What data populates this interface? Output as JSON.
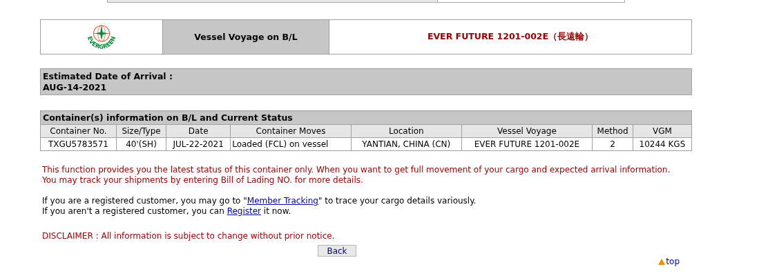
{
  "logo": {
    "text": "EVERGREEN"
  },
  "header": {
    "label": "Vessel Voyage on B/L",
    "value": "EVER FUTURE 1201-002E（長遠輪）"
  },
  "arrival": {
    "label": "Estimated Date of Arrival :",
    "date": "AUG-14-2021"
  },
  "table": {
    "title": "Container(s) information on B/L and Current Status",
    "columns": [
      "Container No.",
      "Size/Type",
      "Date",
      "Container Moves",
      "Location",
      "Vessel Voyage",
      "Method",
      "VGM"
    ],
    "rows": [
      [
        "TXGU5783571",
        "40'(SH)",
        "JUL-22-2021",
        "Loaded (FCL) on vessel",
        "YANTIAN, CHINA (CN)",
        "EVER FUTURE 1201-002E",
        "2",
        "10244 KGS"
      ]
    ]
  },
  "notice": [
    "This function provides you the latest status of this container only. When you want to get full movement of your cargo and expected arrival information.",
    "You may track your shipments by entering Bill of Lading NO. for more details."
  ],
  "member_line": {
    "before": "If you are a registered customer, you may go to \"",
    "link": "Member Tracking",
    "after": "\" to trace your cargo details variously."
  },
  "register_line": {
    "before": "If you aren't a registered customer, you can ",
    "link": "Register",
    "after": " it now."
  },
  "disclaimer": "DISCLAIMER : All information is subject to change without prior notice.",
  "back_button": "Back",
  "top_link": "top"
}
